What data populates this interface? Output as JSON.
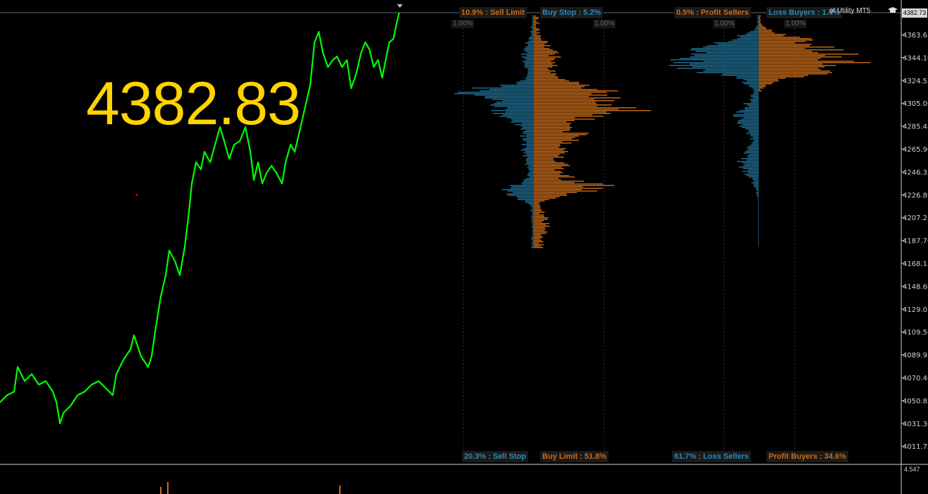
{
  "current_price": "4382.83",
  "price_tag": "4382.73",
  "indicator_title": "ot Utility MT5",
  "price_axis": [
    "4363.65",
    "4344.10",
    "4324.55",
    "4305.00",
    "4285.45",
    "4265.90",
    "4246.35",
    "4226.80",
    "4207.25",
    "4187.70",
    "4168.15",
    "4148.60",
    "4129.05",
    "4109.50",
    "4089.95",
    "4070.40",
    "4050.85",
    "4031.30",
    "4011.75"
  ],
  "volume_axis_label": "4.547",
  "order_book": {
    "top_left_sell_limit": "10.9% : Sell Limit",
    "top_left_buy_stop": "Buy Stop : 5.2%",
    "bottom_left_sell_stop": "20.3% : Sell Stop",
    "bottom_left_buy_limit": "Buy Limit : 51.8%",
    "scale_left_a": "1.00%",
    "scale_left_b": "1.00%"
  },
  "position_book": {
    "top_profit_sellers": "0.5% : Profit Sellers",
    "top_loss_buyers": "Loss Buyers : 1.4%",
    "bottom_loss_sellers": "61.7% : Loss Sellers",
    "bottom_profit_buyers": "Profit Buyers : 34.6%",
    "scale_right_a": "1.00%",
    "scale_right_b": "1.00%"
  },
  "colors": {
    "price_line": "#00ff00",
    "big_price": "#ffd400",
    "orange": "#c96b1a",
    "blue": "#1f6f93"
  }
}
